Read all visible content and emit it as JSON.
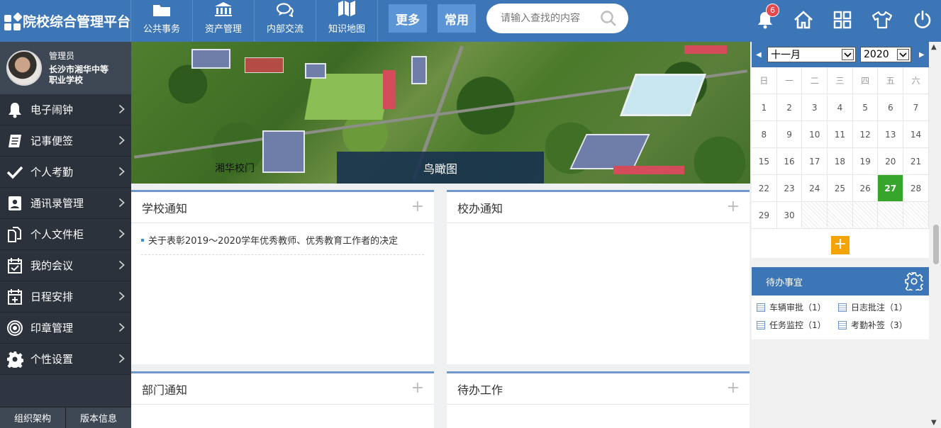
{
  "app": {
    "title": "院校综合管理平台"
  },
  "nav": {
    "items": [
      {
        "label": "公共事务",
        "icon": "folder-icon"
      },
      {
        "label": "资产管理",
        "icon": "bank-icon"
      },
      {
        "label": "内部交流",
        "icon": "chat-icon"
      },
      {
        "label": "知识地图",
        "icon": "map-icon"
      }
    ],
    "more_label": "更多",
    "common_label": "常用"
  },
  "search": {
    "placeholder": "请输入查找的内容"
  },
  "header_icons": {
    "notification_count": "6"
  },
  "user": {
    "role": "管理员",
    "org": "长沙市湘华中等职业学校"
  },
  "sidebar": {
    "items": [
      {
        "label": "电子闹钟",
        "icon": "bell-icon"
      },
      {
        "label": "记事便签",
        "icon": "notebook-icon"
      },
      {
        "label": "个人考勤",
        "icon": "check-icon"
      },
      {
        "label": "通讯录管理",
        "icon": "contact-card-icon"
      },
      {
        "label": "个人文件柜",
        "icon": "files-icon"
      },
      {
        "label": "我的会议",
        "icon": "calendar-check-icon"
      },
      {
        "label": "日程安排",
        "icon": "calendar-plus-icon"
      },
      {
        "label": "印章管理",
        "icon": "seal-icon"
      },
      {
        "label": "个性设置",
        "icon": "gear-icon"
      }
    ],
    "bottom": {
      "org_label": "组织架构",
      "version_label": "版本信息"
    }
  },
  "banner": {
    "caption": "鸟瞰图",
    "left_label": "湘华校门"
  },
  "panels": {
    "school_notice": {
      "title": "学校通知",
      "items": [
        "关于表彰2019～2020学年优秀教师、优秀教育工作者的决定"
      ]
    },
    "office_notice": {
      "title": "校办通知"
    },
    "dept_notice": {
      "title": "部门通知"
    },
    "pending_work": {
      "title": "待办工作"
    }
  },
  "calendar": {
    "month": "十一月",
    "year": "2020",
    "weekdays": [
      "日",
      "一",
      "二",
      "三",
      "四",
      "五",
      "六"
    ],
    "days": [
      "1",
      "2",
      "3",
      "4",
      "5",
      "6",
      "7",
      "8",
      "9",
      "10",
      "11",
      "12",
      "13",
      "14",
      "15",
      "16",
      "17",
      "18",
      "19",
      "20",
      "21",
      "22",
      "23",
      "24",
      "25",
      "26",
      "27",
      "28",
      "29",
      "30"
    ],
    "today": "27",
    "trailing_empty_cells": 5,
    "accent_color": "#37a42c"
  },
  "todo": {
    "title": "待办事宜",
    "items": [
      "车辆审批（1）",
      "日志批注（1）",
      "任务监控（1）",
      "考勤补签（3）"
    ]
  },
  "colors": {
    "primary": "#3c76b7",
    "sidebar_bg": "#2f3641",
    "add_button": "#f5a300",
    "badge": "#e5484d"
  }
}
